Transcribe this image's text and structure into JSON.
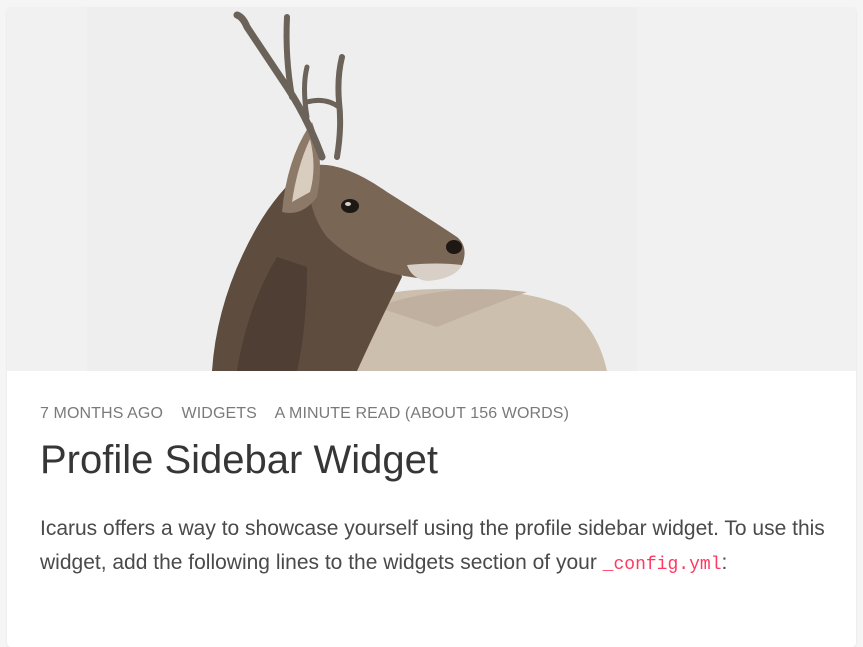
{
  "post": {
    "thumbnail": {
      "subject": "deer-photo",
      "colors": {
        "background": "#f1f1f1",
        "fur_dark": "#5e4c3f",
        "fur_mid": "#7a6655",
        "fur_light": "#cdbfae",
        "antler": "#6b625a"
      }
    },
    "meta": {
      "date": "7 MONTHS AGO",
      "category": "WIDGETS",
      "reading_time": "A MINUTE READ (ABOUT 156 WORDS)"
    },
    "title": "Profile Sidebar Widget",
    "body_text": "Icarus offers a way to showcase yourself using the profile sidebar widget. To use this widget, add the following lines to the widgets section of your",
    "body_code": "_config.yml",
    "body_tail": ":"
  },
  "colors": {
    "code": "#ff3860",
    "title": "#363636",
    "meta": "#7a7a7a",
    "text": "#4a4a4a"
  }
}
